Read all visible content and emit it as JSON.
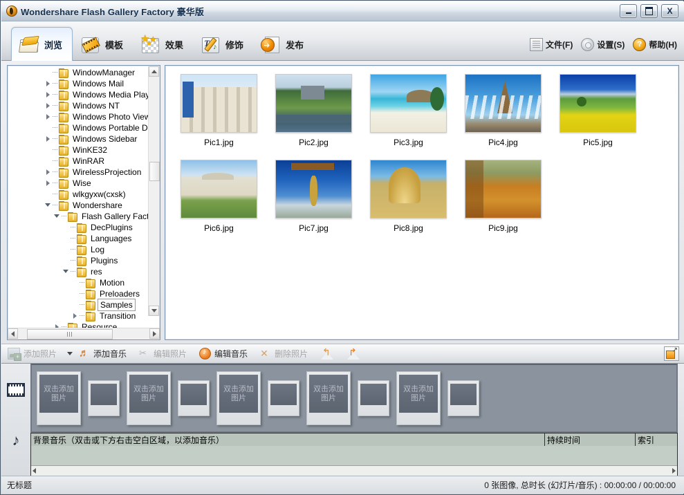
{
  "window": {
    "title": "Wondershare Flash Gallery Factory 豪华版",
    "minimize": "−",
    "maximize": "□",
    "close": "X"
  },
  "ribbon": {
    "tabs": [
      {
        "label": "浏览",
        "icon": "folder-open-icon",
        "active": true
      },
      {
        "label": "模板",
        "icon": "film-strip-icon",
        "active": false
      },
      {
        "label": "效果",
        "icon": "stars-icon",
        "active": false
      },
      {
        "label": "修饰",
        "icon": "text-pencil-icon",
        "active": false
      },
      {
        "label": "发布",
        "icon": "publish-arrow-icon",
        "active": false
      }
    ],
    "menus": [
      {
        "label": "文件(F)",
        "icon": "file-icon"
      },
      {
        "label": "设置(S)",
        "icon": "gear-icon"
      },
      {
        "label": "帮助(H)",
        "icon": "help-icon"
      }
    ]
  },
  "tree": {
    "items": [
      {
        "label": "WindowManager",
        "depth": 4,
        "twisty": "none",
        "selected": false
      },
      {
        "label": "Windows Mail",
        "depth": 4,
        "twisty": "closed",
        "selected": false
      },
      {
        "label": "Windows Media Player",
        "depth": 4,
        "twisty": "closed",
        "selected": false
      },
      {
        "label": "Windows NT",
        "depth": 4,
        "twisty": "closed",
        "selected": false
      },
      {
        "label": "Windows Photo Viewer",
        "depth": 4,
        "twisty": "closed",
        "selected": false
      },
      {
        "label": "Windows Portable Device",
        "depth": 4,
        "twisty": "none",
        "selected": false
      },
      {
        "label": "Windows Sidebar",
        "depth": 4,
        "twisty": "closed",
        "selected": false
      },
      {
        "label": "WinKE32",
        "depth": 4,
        "twisty": "none",
        "selected": false
      },
      {
        "label": "WinRAR",
        "depth": 4,
        "twisty": "none",
        "selected": false
      },
      {
        "label": "WirelessProjection",
        "depth": 4,
        "twisty": "closed",
        "selected": false
      },
      {
        "label": "Wise",
        "depth": 4,
        "twisty": "closed",
        "selected": false
      },
      {
        "label": "wlkgyxw(cxsk)",
        "depth": 4,
        "twisty": "none",
        "selected": false
      },
      {
        "label": "Wondershare",
        "depth": 4,
        "twisty": "open",
        "selected": false
      },
      {
        "label": "Flash Gallery Factory",
        "depth": 5,
        "twisty": "open",
        "selected": false
      },
      {
        "label": "DecPlugins",
        "depth": 6,
        "twisty": "none",
        "selected": false
      },
      {
        "label": "Languages",
        "depth": 6,
        "twisty": "none",
        "selected": false
      },
      {
        "label": "Log",
        "depth": 6,
        "twisty": "none",
        "selected": false
      },
      {
        "label": "Plugins",
        "depth": 6,
        "twisty": "none",
        "selected": false
      },
      {
        "label": "res",
        "depth": 6,
        "twisty": "open",
        "selected": false
      },
      {
        "label": "Motion",
        "depth": 7,
        "twisty": "none",
        "selected": false
      },
      {
        "label": "Preloaders",
        "depth": 7,
        "twisty": "none",
        "selected": false
      },
      {
        "label": "Samples",
        "depth": 7,
        "twisty": "none",
        "selected": true
      },
      {
        "label": "Transition",
        "depth": 7,
        "twisty": "closed",
        "selected": false
      },
      {
        "label": "Resource",
        "depth": 5,
        "twisty": "closed",
        "selected": false
      }
    ]
  },
  "thumbnails": [
    {
      "name": "Pic1.jpg",
      "art": "p1"
    },
    {
      "name": "Pic2.jpg",
      "art": "p2"
    },
    {
      "name": "Pic3.jpg",
      "art": "p3"
    },
    {
      "name": "Pic4.jpg",
      "art": "p4"
    },
    {
      "name": "Pic5.jpg",
      "art": "p5"
    },
    {
      "name": "Pic6.jpg",
      "art": "p6"
    },
    {
      "name": "Pic7.jpg",
      "art": "p7"
    },
    {
      "name": "Pic8.jpg",
      "art": "p8"
    },
    {
      "name": "Pic9.jpg",
      "art": "p9"
    }
  ],
  "toolbar": {
    "add_photo": "添加照片",
    "add_music": "添加音乐",
    "edit_photo": "编辑照片",
    "edit_music": "编辑音乐",
    "delete_photo": "删除照片"
  },
  "storyboard": {
    "placeholder": "双击添加图片",
    "slots": [
      "big",
      "small",
      "big",
      "small",
      "big",
      "small",
      "big",
      "small",
      "big",
      "small"
    ]
  },
  "music_track": {
    "col_name": "背景音乐（双击或下方右击空白区域，以添加音乐）",
    "col_duration": "持续时间",
    "col_index": "索引"
  },
  "status": {
    "document": "无标题",
    "info": "0 张图像, 总时长 (幻灯片/音乐) : 00:00:00 / 00:00:00"
  }
}
